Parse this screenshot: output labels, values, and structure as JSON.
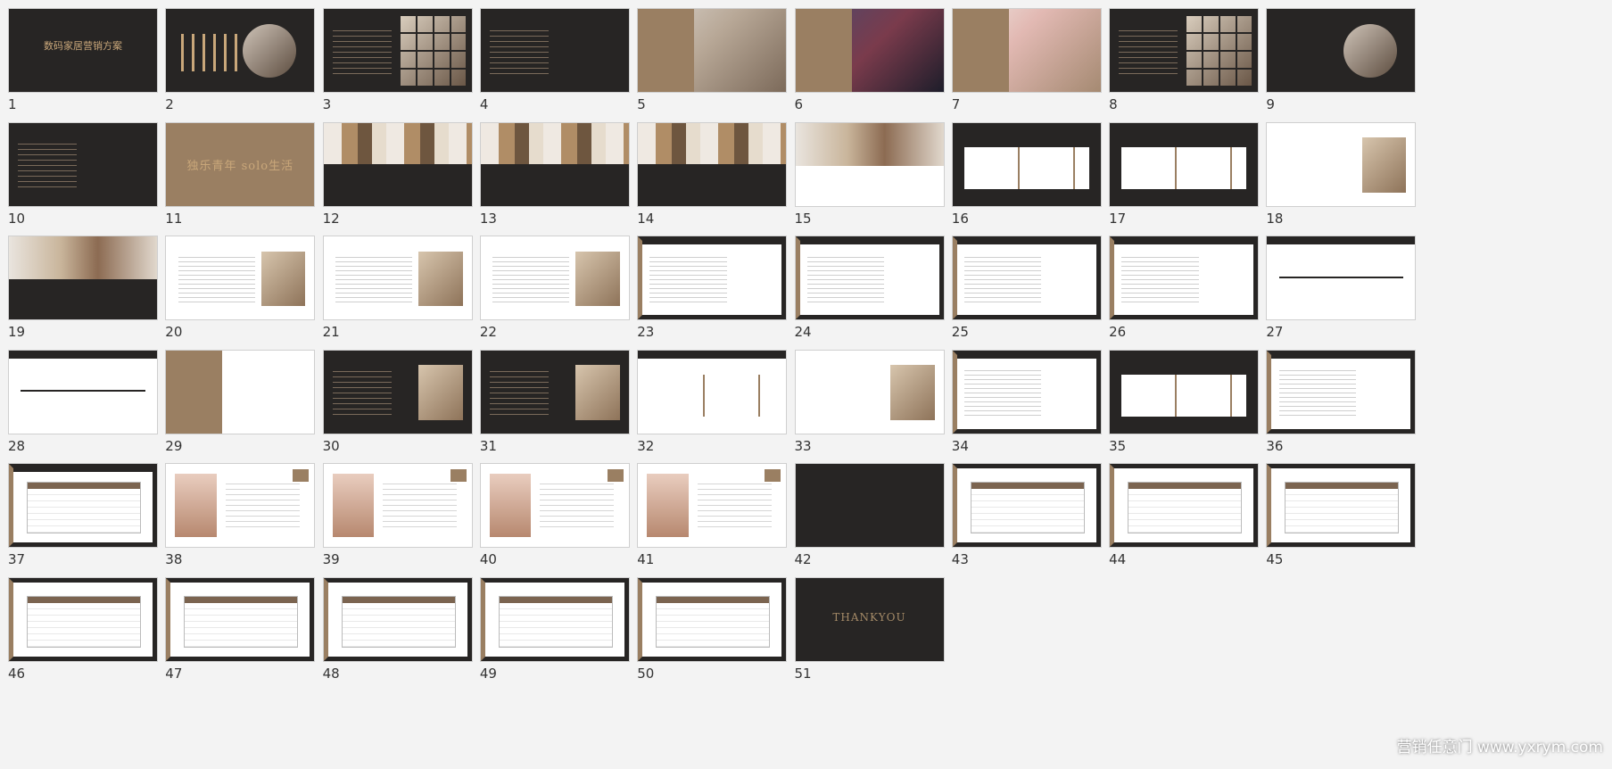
{
  "slides": [
    {
      "n": "1",
      "theme": "cover",
      "title": "数码家居营销方案"
    },
    {
      "n": "2",
      "theme": "cover2"
    },
    {
      "n": "3",
      "theme": "tiles"
    },
    {
      "n": "4",
      "theme": "darktext"
    },
    {
      "n": "5",
      "theme": "brownphoto"
    },
    {
      "n": "6",
      "theme": "cool"
    },
    {
      "n": "7",
      "theme": "flower"
    },
    {
      "n": "8",
      "theme": "tiles"
    },
    {
      "n": "9",
      "theme": "darkcircle"
    },
    {
      "n": "10",
      "theme": "darktext"
    },
    {
      "n": "11",
      "theme": "brown",
      "title": "独乐青年 solo生活"
    },
    {
      "n": "12",
      "theme": "dish"
    },
    {
      "n": "13",
      "theme": "dish"
    },
    {
      "n": "14",
      "theme": "dish"
    },
    {
      "n": "15",
      "theme": "whitedish"
    },
    {
      "n": "16",
      "theme": "darktable"
    },
    {
      "n": "17",
      "theme": "darktable"
    },
    {
      "n": "18",
      "theme": "whitephoto"
    },
    {
      "n": "19",
      "theme": "darkdish"
    },
    {
      "n": "20",
      "theme": "textphoto"
    },
    {
      "n": "21",
      "theme": "textphoto"
    },
    {
      "n": "22",
      "theme": "textphoto"
    },
    {
      "n": "23",
      "theme": "framed"
    },
    {
      "n": "24",
      "theme": "framed"
    },
    {
      "n": "25",
      "theme": "framed"
    },
    {
      "n": "26",
      "theme": "framed"
    },
    {
      "n": "27",
      "theme": "timeline"
    },
    {
      "n": "28",
      "theme": "timeline"
    },
    {
      "n": "29",
      "theme": "person"
    },
    {
      "n": "30",
      "theme": "darklist"
    },
    {
      "n": "31",
      "theme": "darklist"
    },
    {
      "n": "32",
      "theme": "avatars"
    },
    {
      "n": "33",
      "theme": "whitephoto"
    },
    {
      "n": "34",
      "theme": "framed"
    },
    {
      "n": "35",
      "theme": "darktable"
    },
    {
      "n": "36",
      "theme": "framed"
    },
    {
      "n": "37",
      "theme": "framedtable"
    },
    {
      "n": "38",
      "theme": "profile"
    },
    {
      "n": "39",
      "theme": "profile"
    },
    {
      "n": "40",
      "theme": "profile"
    },
    {
      "n": "41",
      "theme": "profile"
    },
    {
      "n": "42",
      "theme": "darkplain"
    },
    {
      "n": "43",
      "theme": "table"
    },
    {
      "n": "44",
      "theme": "table"
    },
    {
      "n": "45",
      "theme": "table"
    },
    {
      "n": "46",
      "theme": "table"
    },
    {
      "n": "47",
      "theme": "table"
    },
    {
      "n": "48",
      "theme": "table"
    },
    {
      "n": "49",
      "theme": "table"
    },
    {
      "n": "50",
      "theme": "table"
    },
    {
      "n": "51",
      "theme": "thanks",
      "title": "THANKYOU"
    }
  ],
  "watermark": "营销任意门 www.yxrym.com"
}
